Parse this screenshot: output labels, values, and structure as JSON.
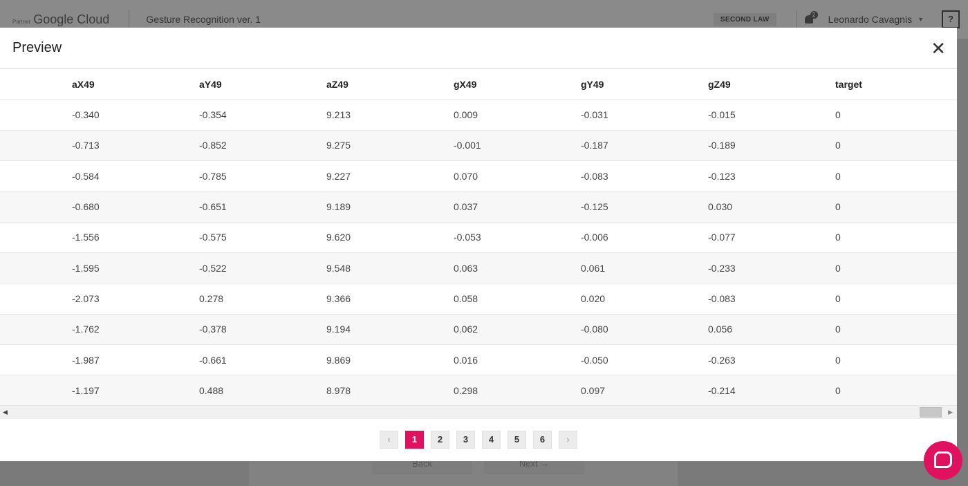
{
  "header": {
    "partner": "Partner",
    "brand": "Google Cloud",
    "project": "Gesture Recognition ver. 1",
    "org": "SECOND LAW",
    "notifications": "2",
    "user": "Leonardo Cavagnis",
    "help": "?"
  },
  "background": {
    "back_label": "Back",
    "next_label": "Next →"
  },
  "modal": {
    "title": "Preview",
    "close_icon": "✕",
    "columns": [
      "",
      "aX49",
      "aY49",
      "aZ49",
      "gX49",
      "gY49",
      "gZ49",
      "target"
    ],
    "rows": [
      [
        "",
        "-0.340",
        "-0.354",
        "9.213",
        "0.009",
        "-0.031",
        "-0.015",
        "0"
      ],
      [
        "",
        "-0.713",
        "-0.852",
        "9.275",
        "-0.001",
        "-0.187",
        "-0.189",
        "0"
      ],
      [
        "",
        "-0.584",
        "-0.785",
        "9.227",
        "0.070",
        "-0.083",
        "-0.123",
        "0"
      ],
      [
        "",
        "-0.680",
        "-0.651",
        "9.189",
        "0.037",
        "-0.125",
        "0.030",
        "0"
      ],
      [
        "",
        "-1.556",
        "-0.575",
        "9.620",
        "-0.053",
        "-0.006",
        "-0.077",
        "0"
      ],
      [
        "",
        "-1.595",
        "-0.522",
        "9.548",
        "0.063",
        "0.061",
        "-0.233",
        "0"
      ],
      [
        "",
        "-2.073",
        "0.278",
        "9.366",
        "0.058",
        "0.020",
        "-0.083",
        "0"
      ],
      [
        "",
        "-1.762",
        "-0.378",
        "9.194",
        "0.062",
        "-0.080",
        "0.056",
        "0"
      ],
      [
        "",
        "-1.987",
        "-0.661",
        "9.869",
        "0.016",
        "-0.050",
        "-0.263",
        "0"
      ],
      [
        "",
        "-1.197",
        "0.488",
        "8.978",
        "0.298",
        "0.097",
        "-0.214",
        "0"
      ]
    ],
    "pagination": {
      "prev": "‹",
      "pages": [
        "1",
        "2",
        "3",
        "4",
        "5",
        "6"
      ],
      "current": "1",
      "next": "›"
    }
  },
  "colors": {
    "accent": "#e0115f"
  }
}
